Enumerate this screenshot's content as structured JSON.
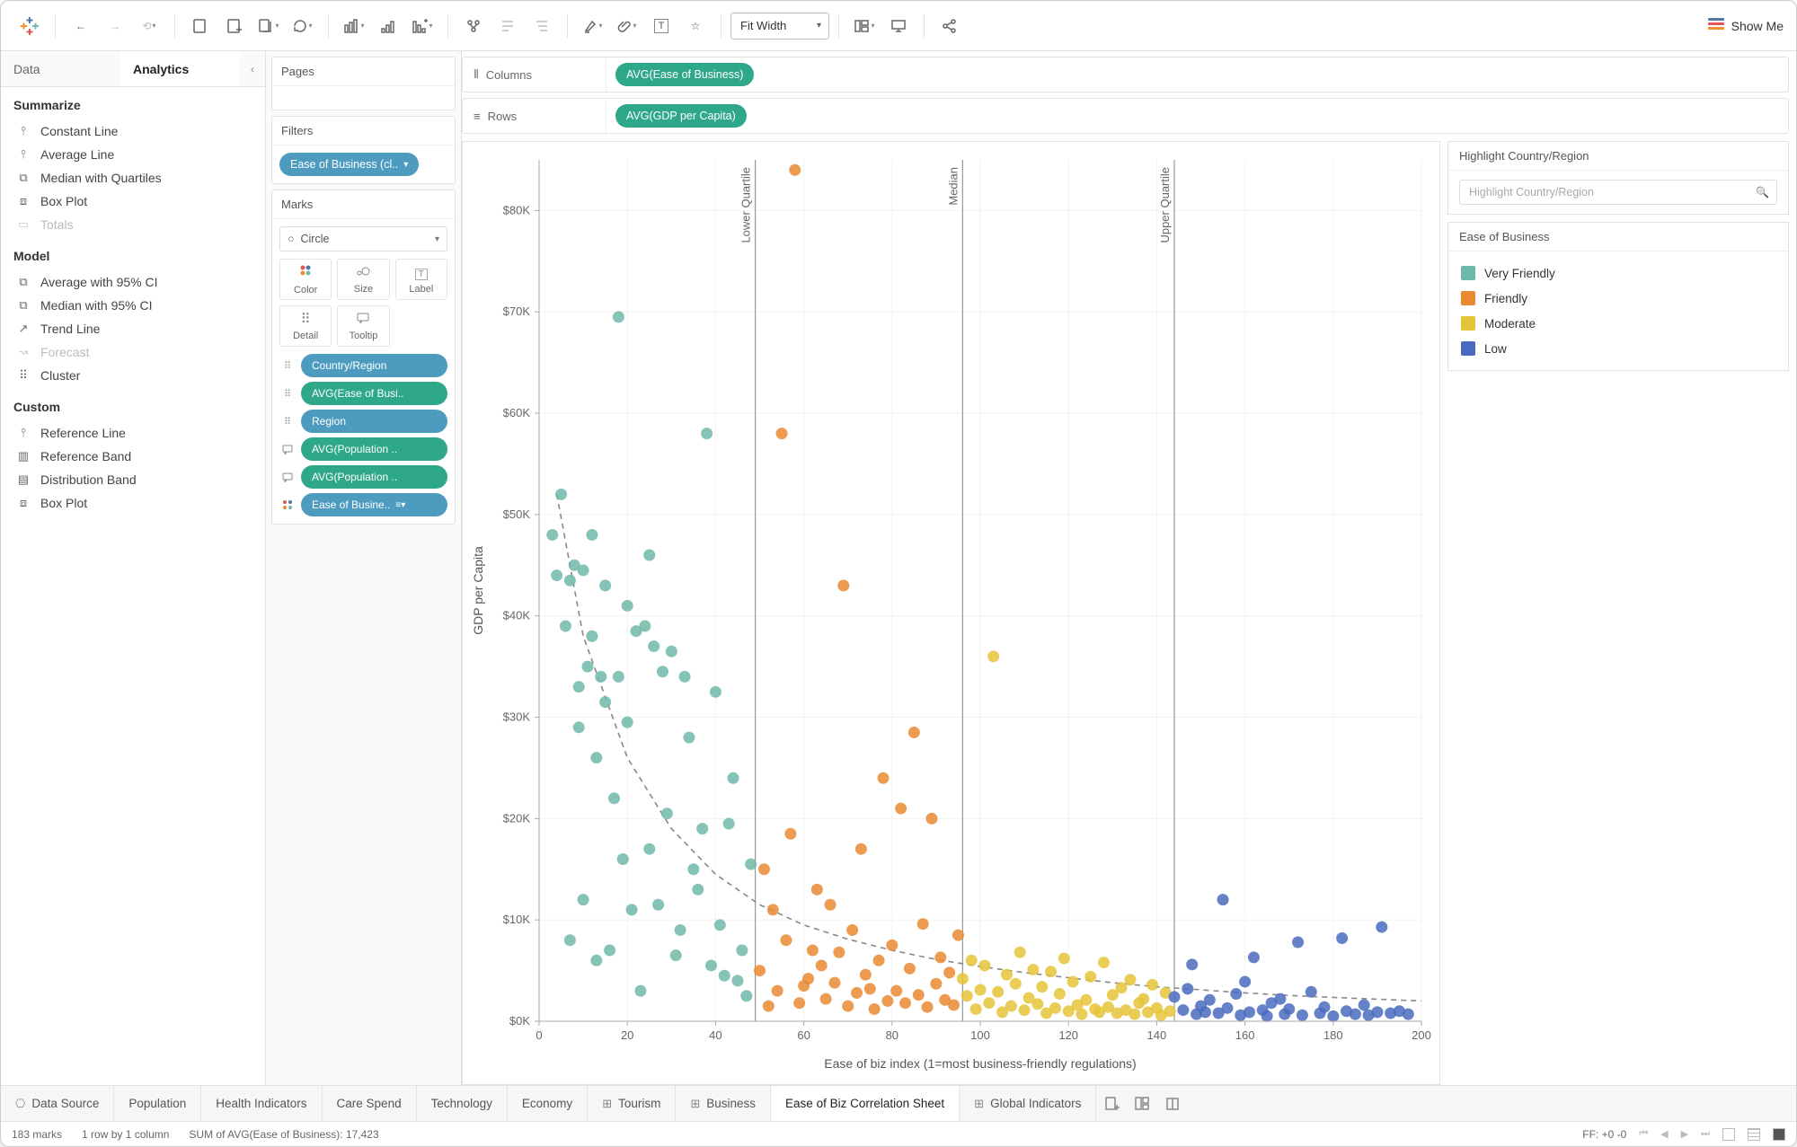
{
  "colors": {
    "friendly": "#e98a33",
    "very_friendly": "#6fb8a8",
    "moderate": "#e6c438",
    "low": "#4a6bbd",
    "pill_teal": "#2fa88a",
    "pill_blue": "#4d9cc0"
  },
  "toolbar": {
    "fit_label": "Fit Width",
    "showme": "Show Me"
  },
  "side": {
    "tab_data": "Data",
    "tab_analytics": "Analytics",
    "summarize": "Summarize",
    "model": "Model",
    "custom": "Custom",
    "items_summarize": [
      "Constant Line",
      "Average Line",
      "Median with Quartiles",
      "Box Plot",
      "Totals"
    ],
    "items_model": [
      "Average with 95% CI",
      "Median with 95% CI",
      "Trend Line",
      "Forecast",
      "Cluster"
    ],
    "items_custom": [
      "Reference Line",
      "Reference Band",
      "Distribution Band",
      "Box Plot"
    ]
  },
  "cards": {
    "pages": "Pages",
    "filters": "Filters",
    "filters_pill": "Ease of Business (cl..",
    "marks": "Marks",
    "mark_type": "Circle",
    "mark_cells": [
      "Color",
      "Size",
      "Label",
      "Detail",
      "Tooltip"
    ],
    "mark_pills": [
      {
        "k": "detail",
        "c": "blue",
        "t": "Country/Region"
      },
      {
        "k": "detail",
        "c": "teal",
        "t": "AVG(Ease of Busi.."
      },
      {
        "k": "detail",
        "c": "blue",
        "t": "Region"
      },
      {
        "k": "tooltip",
        "c": "teal",
        "t": "AVG(Population .."
      },
      {
        "k": "tooltip",
        "c": "teal",
        "t": "AVG(Population .."
      },
      {
        "k": "color",
        "c": "blue",
        "t": "Ease of Busine.."
      }
    ]
  },
  "shelves": {
    "columns": "Columns",
    "rows": "Rows",
    "col_pill": "AVG(Ease of Business)",
    "row_pill": "AVG(GDP per Capita)"
  },
  "rhs": {
    "highlight_title": "Highlight Country/Region",
    "highlight_placeholder": "Highlight Country/Region",
    "legend_title": "Ease of Business",
    "legend": [
      "Very Friendly",
      "Friendly",
      "Moderate",
      "Low"
    ]
  },
  "tabs": {
    "data_source": "Data Source",
    "sheets": [
      "Population",
      "Health Indicators",
      "Care Spend",
      "Technology",
      "Economy",
      "Tourism",
      "Business",
      "Ease of Biz Correlation Sheet",
      "Global Indicators"
    ],
    "active": "Ease of Biz Correlation Sheet"
  },
  "status": {
    "marks": "183 marks",
    "layout": "1 row by 1 column",
    "sum": "SUM of AVG(Ease of Business): 17,423",
    "ff": "FF: +0 -0"
  },
  "chart_data": {
    "type": "scatter",
    "title": "",
    "xlabel": "Ease of biz index (1=most business-friendly regulations)",
    "ylabel": "GDP per Capita",
    "xlim": [
      0,
      200
    ],
    "ylim": [
      0,
      85000
    ],
    "xticks": [
      0,
      20,
      40,
      60,
      80,
      100,
      120,
      140,
      160,
      180,
      200
    ],
    "yticks": [
      0,
      10000,
      20000,
      30000,
      40000,
      50000,
      60000,
      70000,
      80000
    ],
    "ytick_labels": [
      "$0K",
      "$10K",
      "$20K",
      "$30K",
      "$40K",
      "$50K",
      "$60K",
      "$70K",
      "$80K"
    ],
    "reference_lines": [
      {
        "label": "Lower Quartile",
        "x": 49
      },
      {
        "label": "Median",
        "x": 96
      },
      {
        "label": "Upper Quartile",
        "x": 144
      }
    ],
    "series": [
      {
        "name": "Very Friendly",
        "color": "#6fb8a8",
        "points": [
          [
            3,
            48000
          ],
          [
            4,
            44000
          ],
          [
            5,
            52000
          ],
          [
            6,
            39000
          ],
          [
            7,
            43500
          ],
          [
            7,
            8000
          ],
          [
            8,
            45000
          ],
          [
            9,
            33000
          ],
          [
            9,
            29000
          ],
          [
            10,
            12000
          ],
          [
            10,
            44500
          ],
          [
            11,
            35000
          ],
          [
            12,
            38000
          ],
          [
            12,
            48000
          ],
          [
            13,
            26000
          ],
          [
            13,
            6000
          ],
          [
            14,
            34000
          ],
          [
            15,
            31500
          ],
          [
            15,
            43000
          ],
          [
            16,
            7000
          ],
          [
            17,
            22000
          ],
          [
            18,
            34000
          ],
          [
            18,
            69500
          ],
          [
            19,
            16000
          ],
          [
            20,
            41000
          ],
          [
            20,
            29500
          ],
          [
            21,
            11000
          ],
          [
            22,
            38500
          ],
          [
            23,
            3000
          ],
          [
            24,
            39000
          ],
          [
            25,
            46000
          ],
          [
            25,
            17000
          ],
          [
            26,
            37000
          ],
          [
            27,
            11500
          ],
          [
            28,
            34500
          ],
          [
            29,
            20500
          ],
          [
            30,
            36500
          ],
          [
            31,
            6500
          ],
          [
            32,
            9000
          ],
          [
            33,
            34000
          ],
          [
            34,
            28000
          ],
          [
            35,
            15000
          ],
          [
            36,
            13000
          ],
          [
            37,
            19000
          ],
          [
            38,
            58000
          ],
          [
            39,
            5500
          ],
          [
            40,
            32500
          ],
          [
            41,
            9500
          ],
          [
            42,
            4500
          ],
          [
            43,
            19500
          ],
          [
            44,
            24000
          ],
          [
            45,
            4000
          ],
          [
            46,
            7000
          ],
          [
            47,
            2500
          ],
          [
            48,
            15500
          ]
        ]
      },
      {
        "name": "Friendly",
        "color": "#e98a33",
        "points": [
          [
            50,
            5000
          ],
          [
            51,
            15000
          ],
          [
            52,
            1500
          ],
          [
            53,
            11000
          ],
          [
            54,
            3000
          ],
          [
            55,
            58000
          ],
          [
            56,
            8000
          ],
          [
            57,
            18500
          ],
          [
            58,
            84000
          ],
          [
            59,
            1800
          ],
          [
            60,
            3500
          ],
          [
            61,
            4200
          ],
          [
            62,
            7000
          ],
          [
            63,
            13000
          ],
          [
            64,
            5500
          ],
          [
            65,
            2200
          ],
          [
            66,
            11500
          ],
          [
            67,
            3800
          ],
          [
            68,
            6800
          ],
          [
            69,
            43000
          ],
          [
            70,
            1500
          ],
          [
            71,
            9000
          ],
          [
            72,
            2800
          ],
          [
            73,
            17000
          ],
          [
            74,
            4600
          ],
          [
            75,
            3200
          ],
          [
            76,
            1200
          ],
          [
            77,
            6000
          ],
          [
            78,
            24000
          ],
          [
            79,
            2000
          ],
          [
            80,
            7500
          ],
          [
            81,
            3000
          ],
          [
            82,
            21000
          ],
          [
            83,
            1800
          ],
          [
            84,
            5200
          ],
          [
            85,
            28500
          ],
          [
            86,
            2600
          ],
          [
            87,
            9600
          ],
          [
            88,
            1400
          ],
          [
            89,
            20000
          ],
          [
            90,
            3700
          ],
          [
            91,
            6300
          ],
          [
            92,
            2100
          ],
          [
            93,
            4800
          ],
          [
            94,
            1600
          ],
          [
            95,
            8500
          ]
        ]
      },
      {
        "name": "Moderate",
        "color": "#e6c438",
        "points": [
          [
            96,
            4200
          ],
          [
            97,
            2500
          ],
          [
            98,
            6000
          ],
          [
            99,
            1200
          ],
          [
            100,
            3100
          ],
          [
            101,
            5500
          ],
          [
            102,
            1800
          ],
          [
            103,
            36000
          ],
          [
            104,
            2900
          ],
          [
            105,
            900
          ],
          [
            106,
            4600
          ],
          [
            107,
            1500
          ],
          [
            108,
            3700
          ],
          [
            109,
            6800
          ],
          [
            110,
            1100
          ],
          [
            111,
            2300
          ],
          [
            112,
            5100
          ],
          [
            113,
            1700
          ],
          [
            114,
            3400
          ],
          [
            115,
            800
          ],
          [
            116,
            4900
          ],
          [
            117,
            1300
          ],
          [
            118,
            2700
          ],
          [
            119,
            6200
          ],
          [
            120,
            1000
          ],
          [
            121,
            3900
          ],
          [
            122,
            1600
          ],
          [
            123,
            700
          ],
          [
            124,
            2100
          ],
          [
            125,
            4400
          ],
          [
            126,
            1200
          ],
          [
            127,
            900
          ],
          [
            128,
            5800
          ],
          [
            129,
            1400
          ],
          [
            130,
            2600
          ],
          [
            131,
            800
          ],
          [
            132,
            3300
          ],
          [
            133,
            1100
          ],
          [
            134,
            4100
          ],
          [
            135,
            700
          ],
          [
            136,
            1800
          ],
          [
            137,
            2200
          ],
          [
            138,
            900
          ],
          [
            139,
            3600
          ],
          [
            140,
            1300
          ],
          [
            141,
            600
          ],
          [
            142,
            2800
          ],
          [
            143,
            1000
          ]
        ]
      },
      {
        "name": "Low",
        "color": "#4a6bbd",
        "points": [
          [
            144,
            2400
          ],
          [
            146,
            1100
          ],
          [
            147,
            3200
          ],
          [
            148,
            5600
          ],
          [
            149,
            700
          ],
          [
            150,
            1500
          ],
          [
            151,
            900
          ],
          [
            152,
            2100
          ],
          [
            154,
            800
          ],
          [
            155,
            12000
          ],
          [
            156,
            1300
          ],
          [
            158,
            2700
          ],
          [
            159,
            600
          ],
          [
            160,
            3900
          ],
          [
            161,
            900
          ],
          [
            162,
            6300
          ],
          [
            164,
            1100
          ],
          [
            165,
            500
          ],
          [
            166,
            1800
          ],
          [
            168,
            2200
          ],
          [
            169,
            700
          ],
          [
            170,
            1200
          ],
          [
            172,
            7800
          ],
          [
            173,
            600
          ],
          [
            175,
            2900
          ],
          [
            177,
            800
          ],
          [
            178,
            1400
          ],
          [
            180,
            500
          ],
          [
            182,
            8200
          ],
          [
            183,
            1000
          ],
          [
            185,
            700
          ],
          [
            187,
            1600
          ],
          [
            188,
            600
          ],
          [
            190,
            900
          ],
          [
            191,
            9300
          ],
          [
            193,
            800
          ],
          [
            195,
            1000
          ],
          [
            197,
            700
          ]
        ]
      }
    ],
    "trend_curve": [
      [
        4,
        52000
      ],
      [
        10,
        38000
      ],
      [
        20,
        26000
      ],
      [
        30,
        19000
      ],
      [
        40,
        14500
      ],
      [
        50,
        11500
      ],
      [
        60,
        9500
      ],
      [
        70,
        8100
      ],
      [
        80,
        7000
      ],
      [
        90,
        6100
      ],
      [
        100,
        5400
      ],
      [
        110,
        4800
      ],
      [
        120,
        4300
      ],
      [
        130,
        3800
      ],
      [
        140,
        3400
      ],
      [
        150,
        3100
      ],
      [
        160,
        2800
      ],
      [
        170,
        2550
      ],
      [
        180,
        2350
      ],
      [
        190,
        2180
      ],
      [
        200,
        2000
      ]
    ]
  }
}
